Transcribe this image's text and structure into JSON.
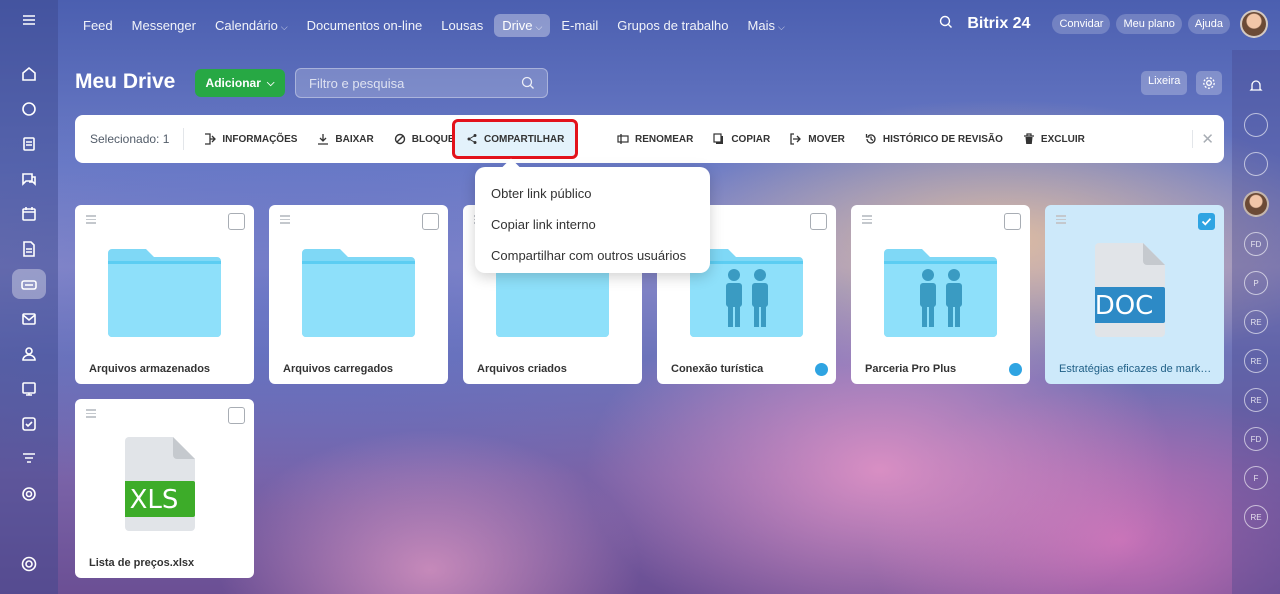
{
  "topnav": {
    "items": [
      {
        "label": "Feed",
        "dropdown": false,
        "active": false
      },
      {
        "label": "Messenger",
        "dropdown": false,
        "active": false
      },
      {
        "label": "Calendário",
        "dropdown": true,
        "active": false
      },
      {
        "label": "Documentos on-line",
        "dropdown": false,
        "active": false
      },
      {
        "label": "Lousas",
        "dropdown": false,
        "active": false
      },
      {
        "label": "Drive",
        "dropdown": true,
        "active": true
      },
      {
        "label": "E-mail",
        "dropdown": false,
        "active": false
      },
      {
        "label": "Grupos de trabalho",
        "dropdown": false,
        "active": false
      },
      {
        "label": "Mais",
        "dropdown": true,
        "active": false
      }
    ],
    "brand": "Bitrix 24",
    "invite_label": "Convidar",
    "plan_label": "Meu plano",
    "help_label": "Ajuda"
  },
  "sidebar_icons": [
    "menu-icon",
    "home-icon",
    "feed-icon",
    "tasks-icon",
    "chat-icon",
    "calendar-icon",
    "documents-icon",
    "drive-icon",
    "mail-icon",
    "groups-icon",
    "boards-icon",
    "checklist-icon",
    "funnel-icon",
    "target-icon",
    "settings-icon"
  ],
  "header": {
    "title": "Meu Drive",
    "add_label": "Adicionar",
    "search_placeholder": "Filtro e pesquisa",
    "trash_label": "Lixeira"
  },
  "toolbar": {
    "selected_label": "Selecionado: 1",
    "actions": {
      "info": "INFORMAÇÕES",
      "download": "BAIXAR",
      "lock": "BLOQUEAR",
      "share": "COMPARTILHAR",
      "rename": "RENOMEAR",
      "copy": "COPIAR",
      "move": "MOVER",
      "history": "HISTÓRICO DE REVISÃO",
      "delete": "EXCLUIR"
    }
  },
  "share_menu": {
    "items": [
      "Obter link público",
      "Copiar link interno",
      "Compartilhar com outros usuários"
    ]
  },
  "files": [
    {
      "name": "Arquivos armazenados",
      "type": "folder",
      "shared": false,
      "selected": false
    },
    {
      "name": "Arquivos carregados",
      "type": "folder",
      "shared": false,
      "selected": false
    },
    {
      "name": "Arquivos criados",
      "type": "folder",
      "shared": false,
      "selected": false
    },
    {
      "name": "Conexão turística",
      "type": "shared-folder",
      "shared": true,
      "selected": false
    },
    {
      "name": "Parceria Pro Plus",
      "type": "shared-folder",
      "shared": true,
      "selected": false
    },
    {
      "name": "Estratégias eficazes de marketin...",
      "type": "doc",
      "badge": "DOC",
      "selected": true
    },
    {
      "name": "Lista de preços.xlsx",
      "type": "xls",
      "badge": "XLS",
      "selected": false
    }
  ],
  "right_rail": [
    "FD",
    "P",
    "RE",
    "RE",
    "RE",
    "FD",
    "F",
    "RE"
  ],
  "colors": {
    "accent_green": "#27a844",
    "highlight_red": "#e3121b",
    "folder_blue": "#7fd8f6",
    "doc_blue": "#2d8ac6",
    "xls_green": "#3dac29"
  }
}
